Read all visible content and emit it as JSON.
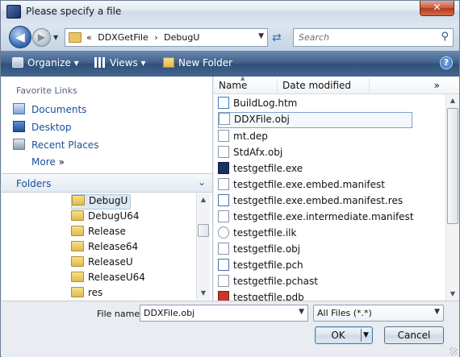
{
  "window": {
    "title": "Please specify a file",
    "close_glyph": "✕"
  },
  "address": {
    "overflow_glyph": "«",
    "crumbs": [
      "DDXGetFile",
      "›",
      "DebugU"
    ],
    "dropdown_glyph": "▼"
  },
  "search": {
    "placeholder": "Search"
  },
  "toolbar": {
    "organize": "Organize",
    "views": "Views",
    "new_folder": "New Folder",
    "help_glyph": "?"
  },
  "left": {
    "favorites_title": "Favorite Links",
    "favorites": [
      "Documents",
      "Desktop",
      "Recent Places"
    ],
    "more_label": "More",
    "more_glyph": "»",
    "folders_title": "Folders",
    "tree": [
      "DebugU",
      "DebugU64",
      "Release",
      "Release64",
      "ReleaseU",
      "ReleaseU64",
      "res"
    ]
  },
  "right": {
    "col_name": "Name",
    "col_date": "Date modified",
    "col_more": "»",
    "files": [
      "BuildLog.htm",
      "DDXFile.obj",
      "mt.dep",
      "StdAfx.obj",
      "testgetfile.exe",
      "testgetfile.exe.embed.manifest",
      "testgetfile.exe.embed.manifest.res",
      "testgetfile.exe.intermediate.manifest",
      "testgetfile.ilk",
      "testgetfile.obj",
      "testgetfile.pch",
      "testgetfile.pchast",
      "testgetfile.pdb"
    ],
    "selected_index": 1
  },
  "bottom": {
    "filename_label": "File name:",
    "filename_value": "DDXFile.obj",
    "filetype_value": "All Files (*.*)",
    "ok_label": "OK",
    "cancel_label": "Cancel"
  },
  "colors": {
    "toolbar": "#3f5f87",
    "link": "#1b4f9c",
    "selection": "#7da2ce"
  }
}
